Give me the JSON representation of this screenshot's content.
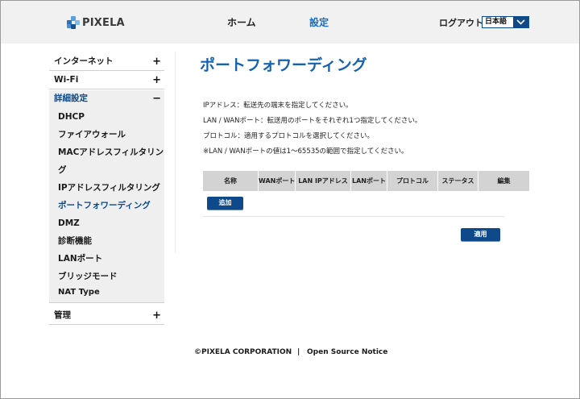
{
  "brand": {
    "name": "PIXELA"
  },
  "header": {
    "nav_home": "ホーム",
    "nav_settings": "設定",
    "logout": "ログアウト",
    "language": "日本語"
  },
  "sidebar": {
    "internet": {
      "label": "インターネット",
      "sign": "+"
    },
    "wifi": {
      "label": "Wi-Fi",
      "sign": "+"
    },
    "advanced": {
      "label": "詳細設定",
      "sign": "−"
    },
    "sub_items": {
      "dhcp": "DHCP",
      "firewall": "ファイアウォール",
      "mac_filter_1": "MACアドレスフィルタリン",
      "mac_filter_2": "グ",
      "ip_filter": "IPアドレスフィルタリング",
      "port_forwarding": "ポートフォワーディング",
      "dmz": "DMZ",
      "diagnostics": "診断機能",
      "lan_port": "LANポート",
      "bridge_mode": "ブリッジモード",
      "nat_type": "NAT Type"
    },
    "admin": {
      "label": "管理",
      "sign": "+"
    }
  },
  "main": {
    "title": "ポートフォワーディング",
    "descriptions": [
      "IPアドレス：転送先の端末を指定してください。",
      "LAN / WANポート：転送用のポートをそれぞれ1つ指定してください。",
      "プロトコル：適用するプロトコルを選択してください。",
      "※LAN / WANポートの値は1〜65535の範囲で指定してください。"
    ],
    "table_headers": [
      "名称",
      "WANポート",
      "LAN IPアドレス",
      "LANポート",
      "プロトコル",
      "ステータス",
      "編集"
    ],
    "add_button": "追加",
    "apply_button": "適用"
  },
  "footer": {
    "copyright": "©PIXELA  CORPORATION",
    "separator": "|",
    "oss_link": "Open Source Notice"
  },
  "colors": {
    "accent": "#0e4a8a",
    "title_blue": "#1462b0",
    "header_bg": "#f1f1f1",
    "table_head_bg": "#d3d3d3"
  }
}
